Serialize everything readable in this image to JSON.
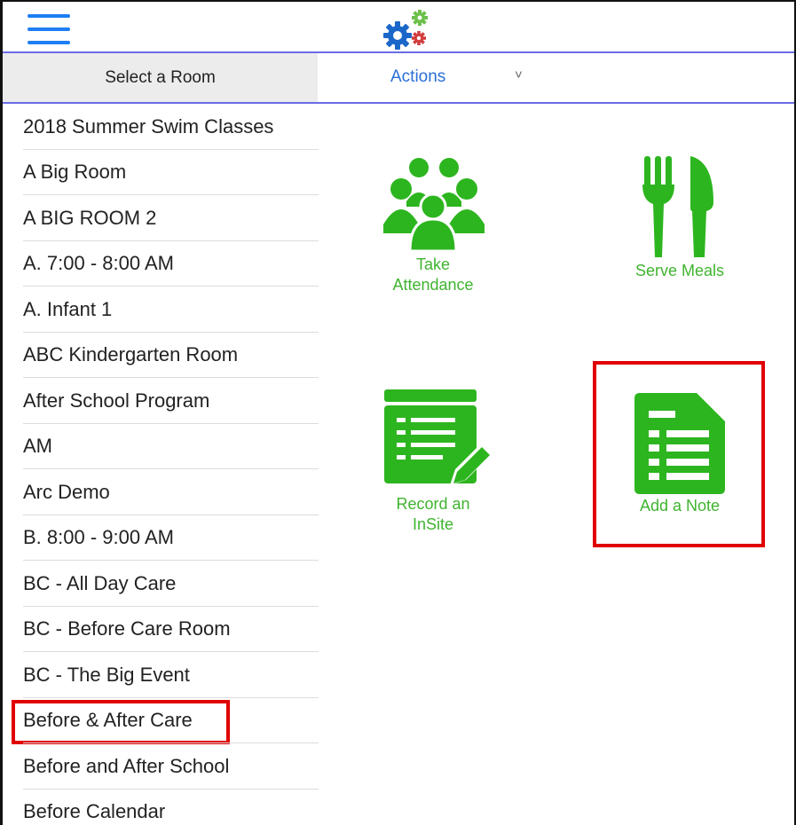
{
  "header": {
    "menu_icon": "hamburger-menu-icon",
    "logo_icon": "gears-logo-icon"
  },
  "tabs": {
    "select_room": "Select a Room",
    "actions": "Actions",
    "actions_chevron": "˅"
  },
  "rooms": [
    "2018 Summer Swim Classes",
    "A Big Room",
    "A BIG ROOM 2",
    "A. 7:00 - 8:00 AM",
    "A. Infant 1",
    "ABC Kindergarten Room",
    "After School Program",
    "AM",
    "Arc Demo",
    "B. 8:00 - 9:00 AM",
    "BC - All Day Care",
    "BC - Before Care Room",
    "BC - The Big Event",
    "Before & After Care",
    "Before and After School",
    "Before Calendar"
  ],
  "highlighted_room_index": 13,
  "actions": {
    "attendance": {
      "line1": "Take",
      "line2": "Attendance",
      "icon": "people-group-icon"
    },
    "meals": {
      "line1": "Serve Meals",
      "icon": "fork-knife-icon"
    },
    "insite": {
      "line1": "Record an",
      "line2": "InSite",
      "icon": "list-pencil-icon"
    },
    "note": {
      "line1": "Add a Note",
      "icon": "note-document-icon"
    }
  },
  "colors": {
    "accent_green": "#3fb42f",
    "icon_green": "#2db51f",
    "link_blue": "#2b6fd6",
    "menu_blue": "#1e7ef5",
    "highlight_red": "#e00000",
    "divider_purple": "#6c6ce6"
  }
}
